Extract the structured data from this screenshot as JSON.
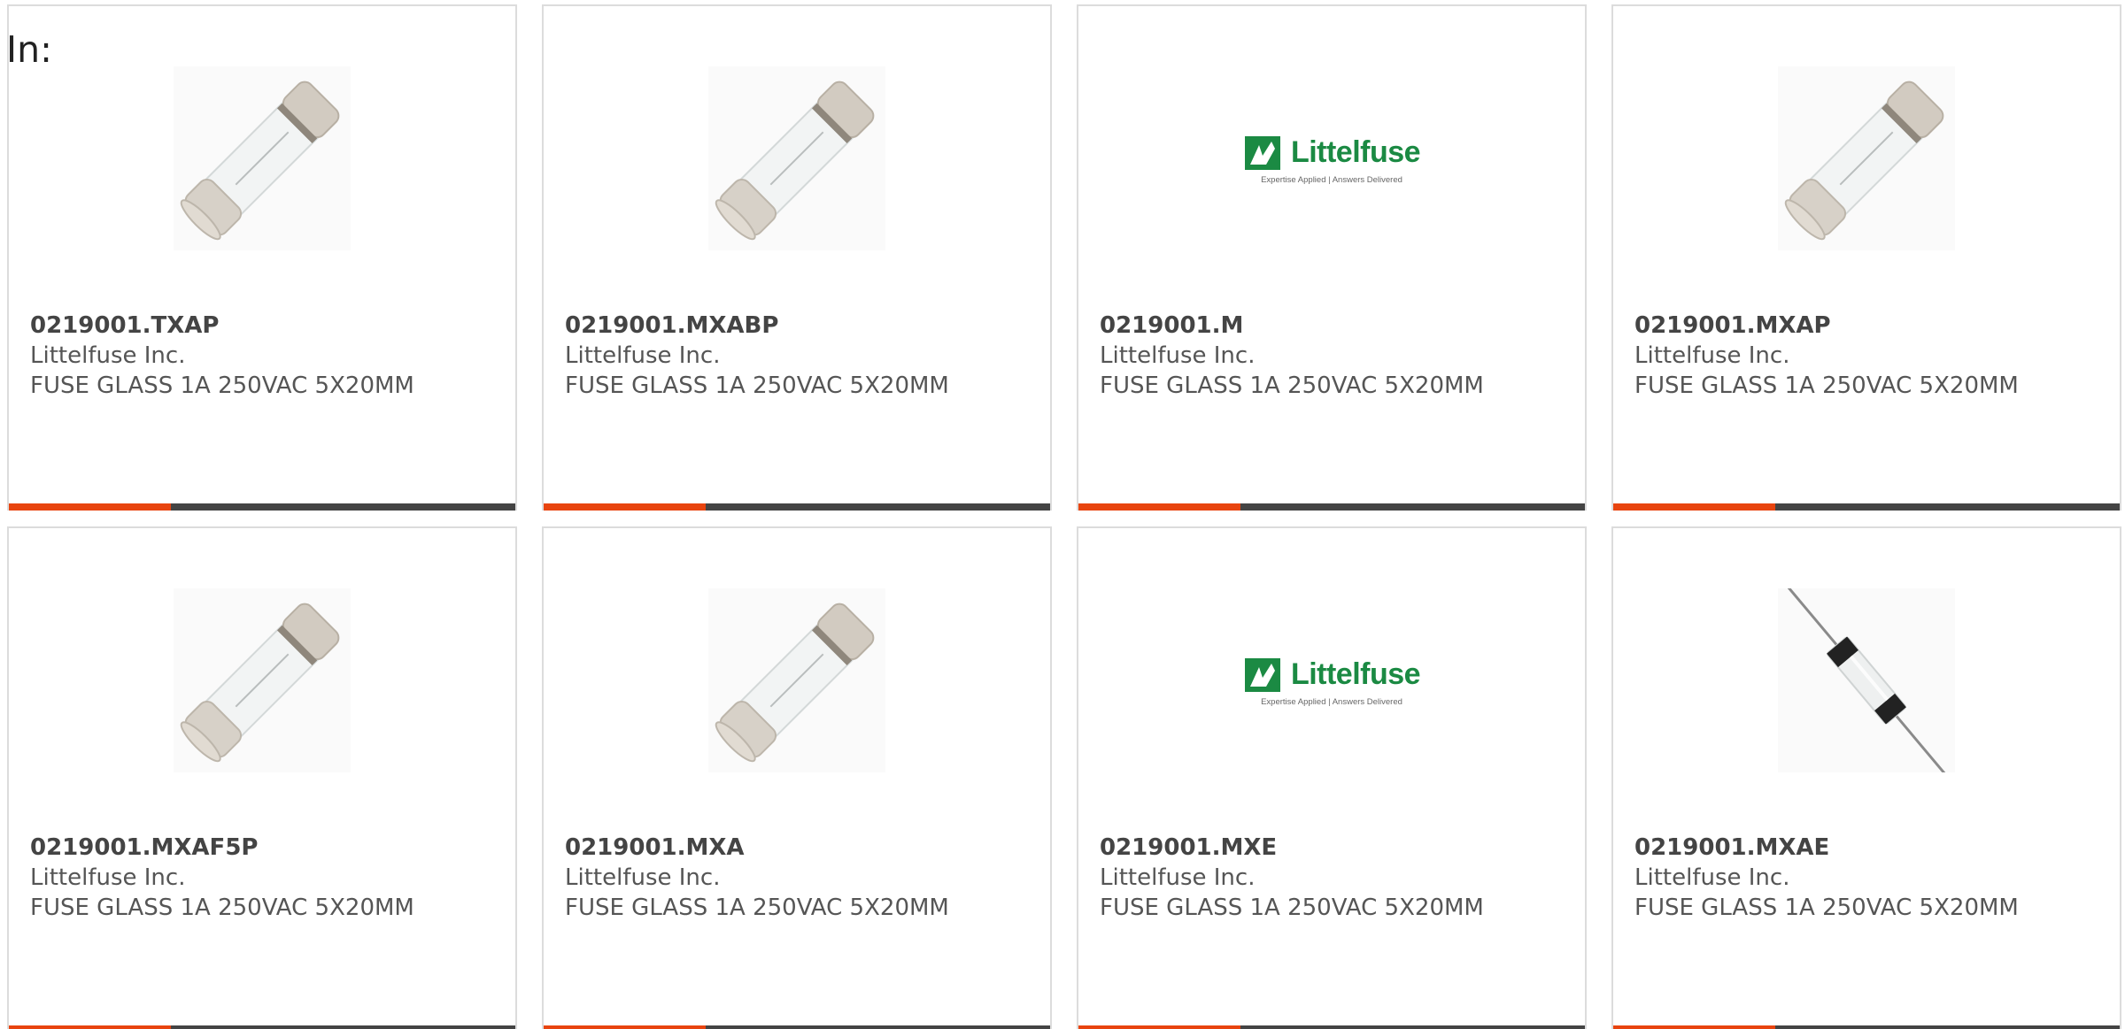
{
  "header": {
    "prefix": "In:"
  },
  "colors": {
    "accent": "#e8440f",
    "bar": "#444444",
    "brand_green": "#1b8a43"
  },
  "products": [
    {
      "part_number": "0219001.TXAP",
      "manufacturer": "Littelfuse Inc.",
      "description": "FUSE GLASS 1A 250VAC 5X20MM",
      "image": "cartridge-fuse-image"
    },
    {
      "part_number": "0219001.MXABP",
      "manufacturer": "Littelfuse Inc.",
      "description": "FUSE GLASS 1A 250VAC 5X20MM",
      "image": "cartridge-fuse-image"
    },
    {
      "part_number": "0219001.M",
      "manufacturer": "Littelfuse Inc.",
      "description": "FUSE GLASS 1A 250VAC 5X20MM",
      "image": "littelfuse-logo",
      "logo": {
        "brand": "Littelfuse",
        "tagline": "Expertise Applied | Answers Delivered"
      }
    },
    {
      "part_number": "0219001.MXAP",
      "manufacturer": "Littelfuse Inc.",
      "description": "FUSE GLASS 1A 250VAC 5X20MM",
      "image": "cartridge-fuse-image"
    },
    {
      "part_number": "0219001.MXAF5P",
      "manufacturer": "Littelfuse Inc.",
      "description": "FUSE GLASS 1A 250VAC 5X20MM",
      "image": "cartridge-fuse-image"
    },
    {
      "part_number": "0219001.MXA",
      "manufacturer": "Littelfuse Inc.",
      "description": "FUSE GLASS 1A 250VAC 5X20MM",
      "image": "cartridge-fuse-image"
    },
    {
      "part_number": "0219001.MXE",
      "manufacturer": "Littelfuse Inc.",
      "description": "FUSE GLASS 1A 250VAC 5X20MM",
      "image": "littelfuse-logo",
      "logo": {
        "brand": "Littelfuse",
        "tagline": "Expertise Applied | Answers Delivered"
      }
    },
    {
      "part_number": "0219001.MXAE",
      "manufacturer": "Littelfuse Inc.",
      "description": "FUSE GLASS 1A 250VAC 5X20MM",
      "image": "axial-lead-fuse-image"
    }
  ]
}
